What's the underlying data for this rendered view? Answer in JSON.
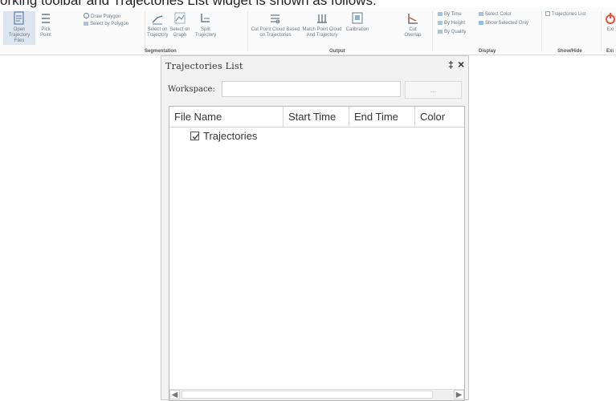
{
  "caption": "orking toolbar and Trajectories List widget is shown as follows:",
  "ribbon": {
    "buttons": {
      "open_trajectory": "Open Trajectory Files",
      "pick_point": "Pick Point",
      "draw_polygon": "Draw Polygon",
      "select_by_polygon": "Select by Polygon",
      "select_on_trajectory": "Select on Trajectory",
      "select_on_graph": "Select on Graph",
      "split_trajectory": "Split Trajectory",
      "cut_point_cloud": "Cut Point Cloud Based on Trajectories",
      "match_point_cloud": "Match Point Cloud And Trajectory",
      "calibration": "Calibration",
      "cut_overlap": "Cut Overlap",
      "by_time": "By Time",
      "by_height": "By Height",
      "by_quality": "By Quality",
      "select_color": "Select Color",
      "show_selected_only": "Show Selected Only",
      "trajectories_list": "Trajectories List",
      "exit": "Exi"
    },
    "groups": {
      "segmentation": "Segmentation",
      "output": "Output",
      "display": "Display",
      "show_hide": "Show/Hide",
      "exit": "Exi"
    }
  },
  "panel": {
    "title": "Trajectories List",
    "pin_glyph": "‡",
    "close_glyph": "×",
    "workspace_label": "Workspace:",
    "workspace_value": "",
    "browse_label": "...",
    "columns": [
      "File Name",
      "Start Time",
      "End Time",
      "Color"
    ],
    "tree_items": [
      {
        "label": "Trajectories",
        "checked": true
      }
    ]
  },
  "colors": {
    "accent": "#3a7bd5",
    "icon_gray": "#6a7a88"
  }
}
